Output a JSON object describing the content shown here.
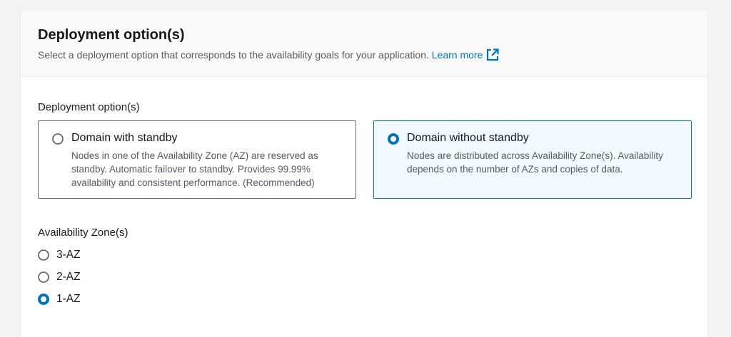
{
  "colors": {
    "accent": "#0073bb",
    "selected_background": "#f1faff",
    "border": "#687078",
    "secondary_text": "#545b64"
  },
  "header": {
    "title": "Deployment option(s)",
    "description": "Select a deployment option that corresponds to the availability goals for your application.",
    "learn_more": "Learn more",
    "learn_more_icon": "external-link-icon"
  },
  "deployment": {
    "label": "Deployment option(s)",
    "options": [
      {
        "title": "Domain with standby",
        "description": "Nodes in one of the Availability Zone (AZ) are reserved as standby. Automatic failover to standby. Provides 99.99% availability and consistent performance. (Recommended)",
        "selected": false
      },
      {
        "title": "Domain without standby",
        "description": "Nodes are distributed across Availability Zone(s). Availability depends on the number of AZs and copies of data.",
        "selected": true
      }
    ]
  },
  "availability_zones": {
    "label": "Availability Zone(s)",
    "options": [
      {
        "label": "3-AZ",
        "selected": false
      },
      {
        "label": "2-AZ",
        "selected": false
      },
      {
        "label": "1-AZ",
        "selected": true
      }
    ],
    "selected_value": "1-AZ"
  }
}
